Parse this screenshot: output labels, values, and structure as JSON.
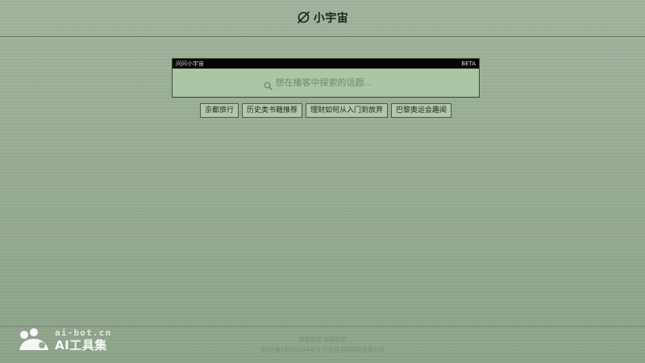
{
  "header": {
    "logo_text": "小宇宙",
    "logo_icon": "planet-icon"
  },
  "search": {
    "bar_title": "问问小宇宙",
    "badge": "BETA",
    "placeholder": "想在播客中探索的话题...",
    "icon": "search-icon"
  },
  "suggestions": [
    {
      "label": "京都旅行"
    },
    {
      "label": "历史类书籍推荐"
    },
    {
      "label": "理财如何从入门到放弃"
    },
    {
      "label": "巴黎奥运会趣闻"
    }
  ],
  "footer": {
    "links": [
      "服务协议",
      "隐私政策"
    ],
    "icp": "浙ICP备19032824号-2 宁波自无啊网络有限公司"
  },
  "watermark": {
    "domain": "ai-bot.cn",
    "name": "AI工具集",
    "icon": "bot-logo-icon"
  },
  "colors": {
    "background": "#98ab94",
    "panel_bar": "#050505",
    "panel_body": "#abc6a5",
    "chip_background": "#b4c7ae"
  }
}
